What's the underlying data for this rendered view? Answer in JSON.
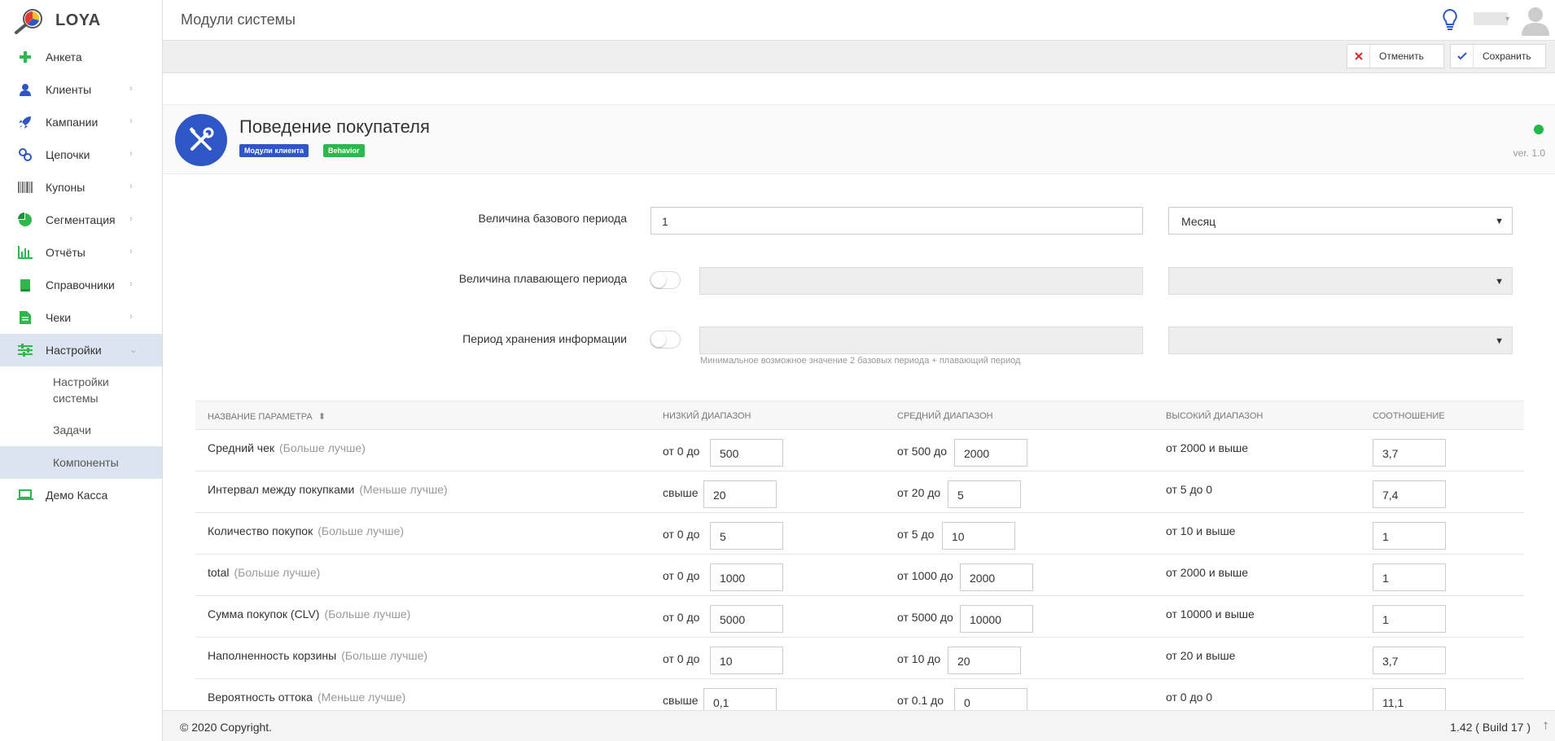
{
  "app": {
    "logo_text": "LOYA"
  },
  "header": {
    "title": "Модули системы"
  },
  "colors": {
    "accent": "#2e56c7",
    "green": "#2eb84c",
    "status": "#23b84a",
    "active_bg": "#dde4f1"
  },
  "sidebar": {
    "items": [
      {
        "label": "Анкета",
        "icon": "plus-icon"
      },
      {
        "label": "Клиенты",
        "icon": "user-icon"
      },
      {
        "label": "Кампании",
        "icon": "rocket-icon"
      },
      {
        "label": "Цепочки",
        "icon": "chain-icon"
      },
      {
        "label": "Купоны",
        "icon": "barcode-icon"
      },
      {
        "label": "Сегментация",
        "icon": "pie-icon"
      },
      {
        "label": "Отчёты",
        "icon": "bar-chart-icon"
      },
      {
        "label": "Справочники",
        "icon": "book-icon"
      },
      {
        "label": "Чеки",
        "icon": "document-icon"
      },
      {
        "label": "Настройки",
        "icon": "sliders-icon"
      },
      {
        "label": "Демо Касса",
        "icon": "laptop-icon"
      }
    ],
    "sub_items": [
      "Настройки системы",
      "Задачи",
      "Компоненты"
    ]
  },
  "toolbar": {
    "cancel_label": "Отменить",
    "save_label": "Сохранить"
  },
  "module": {
    "title": "Поведение покупателя",
    "badge_modules": "Модули клиента",
    "badge_behavior": "Behavior",
    "version": "ver. 1.0"
  },
  "form": {
    "base_period_label": "Величина базового периода",
    "base_period_value": "1",
    "base_period_unit": "Месяц",
    "floating_period_label": "Величина плавающего периода",
    "storage_period_label": "Период хранения информации",
    "storage_hint": "Минимальное возможное значение 2 базовых периода + плавающий период"
  },
  "table": {
    "headers": [
      "Название параметра",
      "Низкий диапазон",
      "Средний диапазон",
      "Высокий диапазон",
      "Соотношение"
    ],
    "rows": [
      {
        "name": "Средний чек",
        "hint": "(Больше лучше)",
        "low_prefix": "от 0 до",
        "low_value": "500",
        "mid_prefix": "от 500 до",
        "mid_value": "2000",
        "high": "от 2000 и выше",
        "ratio": "3,7"
      },
      {
        "name": "Интервал между покупками",
        "hint": "(Меньше лучше)",
        "low_prefix": "свыше",
        "low_value": "20",
        "mid_prefix": "от 20 до",
        "mid_value": "5",
        "high": "от 5 до 0",
        "ratio": "7,4"
      },
      {
        "name": "Количество покупок",
        "hint": "(Больше лучше)",
        "low_prefix": "от 0 до",
        "low_value": "5",
        "mid_prefix": "от 5 до",
        "mid_value": "10",
        "high": "от 10 и выше",
        "ratio": "1"
      },
      {
        "name": "total",
        "hint": "(Больше лучше)",
        "low_prefix": "от 0 до",
        "low_value": "1000",
        "mid_prefix": "от 1000 до",
        "mid_value": "2000",
        "high": "от 2000 и выше",
        "ratio": "1"
      },
      {
        "name": "Сумма покупок (CLV)",
        "hint": "(Больше лучше)",
        "low_prefix": "от 0 до",
        "low_value": "5000",
        "mid_prefix": "от 5000 до",
        "mid_value": "10000",
        "high": "от 10000 и выше",
        "ratio": "1"
      },
      {
        "name": "Наполненность корзины",
        "hint": "(Больше лучше)",
        "low_prefix": "от 0 до",
        "low_value": "10",
        "mid_prefix": "от 10 до",
        "mid_value": "20",
        "high": "от 20 и выше",
        "ratio": "3,7"
      },
      {
        "name": "Вероятность оттока",
        "hint": "(Меньше лучше)",
        "low_prefix": "свыше",
        "low_value": "0,1",
        "mid_prefix": "от 0.1 до",
        "mid_value": "0",
        "high": "от 0 до 0",
        "ratio": "11,1"
      }
    ]
  },
  "footer": {
    "copyright": "© 2020 Copyright.",
    "build": "1.42 ( Build 17 )"
  }
}
